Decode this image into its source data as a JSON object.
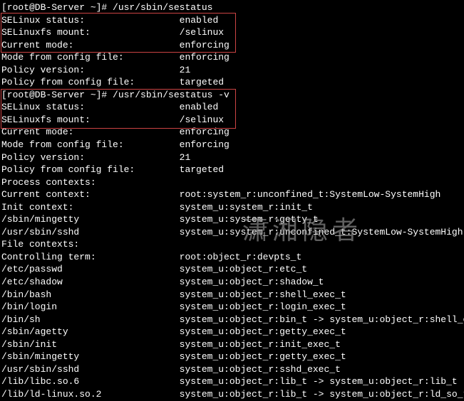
{
  "prompt1": "[root@DB-Server ~]# ",
  "cmd1": "/usr/sbin/sestatus",
  "status1": [
    {
      "k": "SELinux status:",
      "v": "enabled"
    },
    {
      "k": "SELinuxfs mount:",
      "v": "/selinux"
    },
    {
      "k": "Current mode:",
      "v": "enforcing"
    },
    {
      "k": "Mode from config file:",
      "v": "enforcing"
    },
    {
      "k": "Policy version:",
      "v": "21"
    },
    {
      "k": "Policy from config file:",
      "v": "targeted"
    }
  ],
  "prompt2": "[root@DB-Server ~]# ",
  "cmd2": "/usr/sbin/sestatus -v",
  "status2": [
    {
      "k": "SELinux status:",
      "v": "enabled"
    },
    {
      "k": "SELinuxfs mount:",
      "v": "/selinux"
    },
    {
      "k": "Current mode:",
      "v": "enforcing"
    },
    {
      "k": "Mode from config file:",
      "v": "enforcing"
    },
    {
      "k": "Policy version:",
      "v": "21"
    },
    {
      "k": "Policy from config file:",
      "v": "targeted"
    }
  ],
  "proc_header": "Process contexts:",
  "proc": [
    {
      "k": "Current context:",
      "v": "root:system_r:unconfined_t:SystemLow-SystemHigh"
    },
    {
      "k": "Init context:",
      "v": "system_u:system_r:init_t"
    },
    {
      "k": "/sbin/mingetty",
      "v": "system_u:system_r:getty_t"
    },
    {
      "k": "/usr/sbin/sshd",
      "v": "system_u:system_r:unconfined_t:SystemLow-SystemHigh"
    }
  ],
  "file_header": "File contexts:",
  "file": [
    {
      "k": "Controlling term:",
      "v": "root:object_r:devpts_t"
    },
    {
      "k": "/etc/passwd",
      "v": "system_u:object_r:etc_t"
    },
    {
      "k": "/etc/shadow",
      "v": "system_u:object_r:shadow_t"
    },
    {
      "k": "/bin/bash",
      "v": "system_u:object_r:shell_exec_t"
    },
    {
      "k": "/bin/login",
      "v": "system_u:object_r:login_exec_t"
    },
    {
      "k": "/bin/sh",
      "v": "system_u:object_r:bin_t -> system_u:object_r:shell_exec_t"
    },
    {
      "k": "/sbin/agetty",
      "v": "system_u:object_r:getty_exec_t"
    },
    {
      "k": "/sbin/init",
      "v": "system_u:object_r:init_exec_t"
    },
    {
      "k": "/sbin/mingetty",
      "v": "system_u:object_r:getty_exec_t"
    },
    {
      "k": "/usr/sbin/sshd",
      "v": "system_u:object_r:sshd_exec_t"
    },
    {
      "k": "/lib/libc.so.6",
      "v": "system_u:object_r:lib_t -> system_u:object_r:lib_t"
    },
    {
      "k": "/lib/ld-linux.so.2",
      "v": "system_u:object_r:lib_t -> system_u:object_r:ld_so_t"
    }
  ],
  "watermark": "潇湘隐者"
}
